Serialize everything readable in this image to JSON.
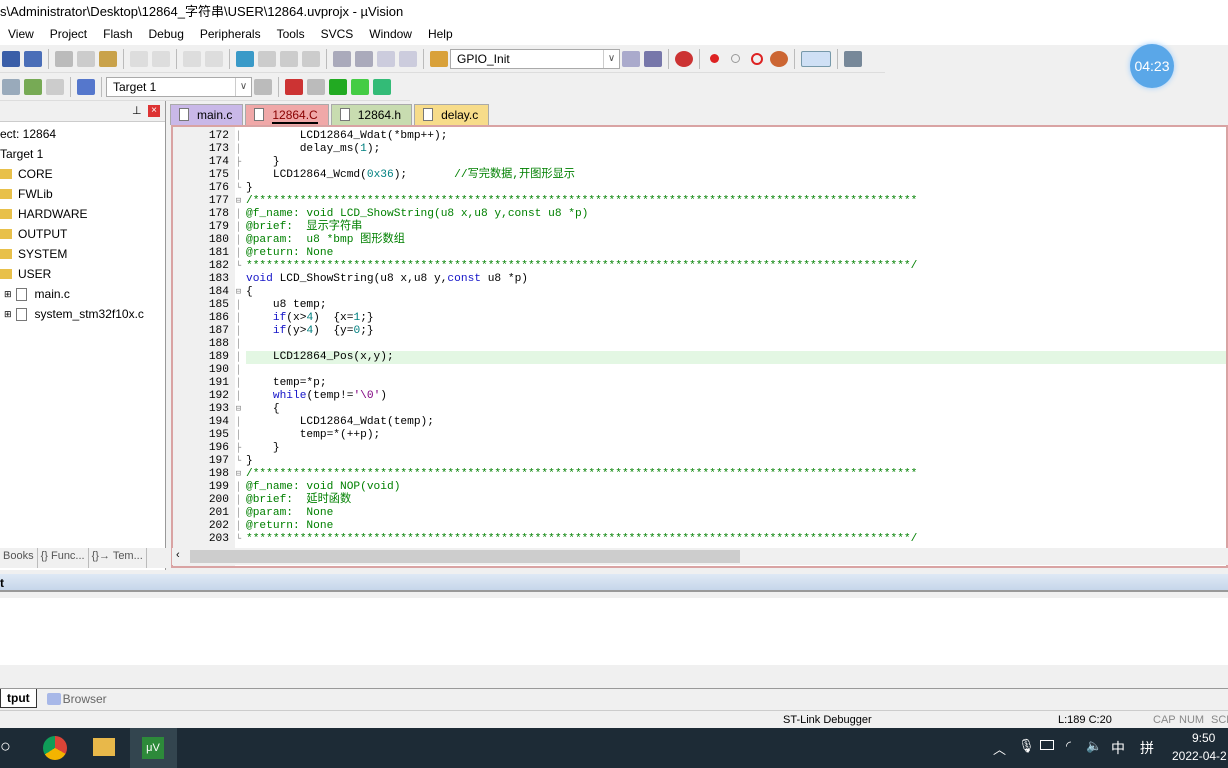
{
  "title": "s\\Administrator\\Desktop\\12864_字符串\\USER\\12864.uvprojx - µVision",
  "menu": [
    "View",
    "Project",
    "Flash",
    "Debug",
    "Peripherals",
    "Tools",
    "SVCS",
    "Window",
    "Help"
  ],
  "toolbar": {
    "function_combo": "GPIO_Init",
    "target_combo": "Target 1"
  },
  "timer": "04:23",
  "project": {
    "header_label": "ect: 12864",
    "target": "Target 1",
    "groups": [
      "CORE",
      "FWLib",
      "HARDWARE",
      "OUTPUT",
      "SYSTEM",
      "USER"
    ],
    "files": [
      "main.c",
      "system_stm32f10x.c"
    ]
  },
  "tabs": [
    {
      "label": "main.c",
      "color": "#c9b8e8"
    },
    {
      "label": "12864.C",
      "color": "#f0a8a8",
      "active": true
    },
    {
      "label": "12864.h",
      "color": "#c8dcb0"
    },
    {
      "label": "delay.c",
      "color": "#f7dc8a"
    }
  ],
  "code": [
    {
      "n": "172",
      "f": "│",
      "s": [
        [
          "        LCD12864_Wdat(*bmp++);",
          ""
        ]
      ]
    },
    {
      "n": "173",
      "f": "│",
      "s": [
        [
          "        delay_ms(",
          ""
        ],
        [
          "1",
          "n"
        ],
        [
          ");",
          ""
        ]
      ]
    },
    {
      "n": "174",
      "f": "├",
      "s": [
        [
          "    }",
          ""
        ]
      ]
    },
    {
      "n": "175",
      "f": "│",
      "s": [
        [
          "    LCD12864_Wcmd(",
          ""
        ],
        [
          "0x36",
          "n"
        ],
        [
          ");       ",
          ""
        ],
        [
          "//写完数据,开图形显示",
          "c"
        ]
      ]
    },
    {
      "n": "176",
      "f": "└",
      "s": [
        [
          "}",
          ""
        ]
      ]
    },
    {
      "n": "177",
      "f": "⊟",
      "s": [
        [
          "/***************************************************************************************************",
          "c"
        ]
      ]
    },
    {
      "n": "178",
      "f": "│",
      "s": [
        [
          "@f_name: void LCD_ShowString(u8 x,u8 y,const u8 *p)",
          "c"
        ]
      ]
    },
    {
      "n": "179",
      "f": "│",
      "s": [
        [
          "@brief:  显示字符串",
          "c"
        ]
      ]
    },
    {
      "n": "180",
      "f": "│",
      "s": [
        [
          "@param:  u8 *bmp 图形数组",
          "c"
        ]
      ]
    },
    {
      "n": "181",
      "f": "│",
      "s": [
        [
          "@return: None",
          "c"
        ]
      ]
    },
    {
      "n": "182",
      "f": "└",
      "s": [
        [
          "***************************************************************************************************/",
          "c"
        ]
      ]
    },
    {
      "n": "183",
      "f": "",
      "s": [
        [
          "void",
          "k"
        ],
        [
          " LCD_ShowString(u8 x,u8 y,",
          ""
        ],
        [
          "const",
          "k"
        ],
        [
          " u8 *p)",
          ""
        ]
      ]
    },
    {
      "n": "184",
      "f": "⊟",
      "s": [
        [
          "{",
          ""
        ]
      ]
    },
    {
      "n": "185",
      "f": "│",
      "s": [
        [
          "    u8 temp;",
          ""
        ]
      ]
    },
    {
      "n": "186",
      "f": "│",
      "s": [
        [
          "    ",
          ""
        ],
        [
          "if",
          "k"
        ],
        [
          "(x>",
          ""
        ],
        [
          "4",
          "n"
        ],
        [
          ")  {x=",
          ""
        ],
        [
          "1",
          "n"
        ],
        [
          ";}",
          ""
        ]
      ]
    },
    {
      "n": "187",
      "f": "│",
      "s": [
        [
          "    ",
          ""
        ],
        [
          "if",
          "k"
        ],
        [
          "(y>",
          ""
        ],
        [
          "4",
          "n"
        ],
        [
          ")  {y=",
          ""
        ],
        [
          "0",
          "n"
        ],
        [
          ";}",
          ""
        ]
      ]
    },
    {
      "n": "188",
      "f": "│",
      "s": [
        [
          "",
          ""
        ]
      ]
    },
    {
      "n": "189",
      "f": "│",
      "hl": true,
      "s": [
        [
          "    LCD12864_Pos(x,y);",
          ""
        ]
      ]
    },
    {
      "n": "190",
      "f": "│",
      "s": [
        [
          "",
          ""
        ]
      ]
    },
    {
      "n": "191",
      "f": "│",
      "s": [
        [
          "    temp=*p;",
          ""
        ]
      ]
    },
    {
      "n": "192",
      "f": "│",
      "s": [
        [
          "    ",
          ""
        ],
        [
          "while",
          "k"
        ],
        [
          "(temp!=",
          ""
        ],
        [
          "'\\0'",
          "s"
        ],
        [
          ")",
          ""
        ]
      ]
    },
    {
      "n": "193",
      "f": "⊟",
      "s": [
        [
          "    {",
          ""
        ]
      ]
    },
    {
      "n": "194",
      "f": "│",
      "s": [
        [
          "        LCD12864_Wdat(temp);",
          ""
        ]
      ]
    },
    {
      "n": "195",
      "f": "│",
      "s": [
        [
          "        temp=*(++p);",
          ""
        ]
      ]
    },
    {
      "n": "196",
      "f": "├",
      "s": [
        [
          "    }",
          ""
        ]
      ]
    },
    {
      "n": "197",
      "f": "└",
      "s": [
        [
          "}",
          ""
        ]
      ]
    },
    {
      "n": "198",
      "f": "⊟",
      "s": [
        [
          "/***************************************************************************************************",
          "c"
        ]
      ]
    },
    {
      "n": "199",
      "f": "│",
      "s": [
        [
          "@f_name: void NOP(void)",
          "c"
        ]
      ]
    },
    {
      "n": "200",
      "f": "│",
      "s": [
        [
          "@brief:  延时函数",
          "c"
        ]
      ]
    },
    {
      "n": "201",
      "f": "│",
      "s": [
        [
          "@param:  None",
          "c"
        ]
      ]
    },
    {
      "n": "202",
      "f": "│",
      "s": [
        [
          "@return: None",
          "c"
        ]
      ]
    },
    {
      "n": "203",
      "f": "└",
      "s": [
        [
          "***************************************************************************************************/",
          "c"
        ]
      ]
    }
  ],
  "left_tabs": [
    "Books",
    "{} Func...",
    "{}→ Tem..."
  ],
  "output_header": "t",
  "output_tabs": [
    "tput",
    "Browser"
  ],
  "status": {
    "debugger": "ST-Link Debugger",
    "position": "L:189 C:20",
    "cap": "CAP",
    "num": "NUM",
    "scrl": "SCR"
  },
  "taskbar": {
    "time": "9:50",
    "date": "2022-04-2",
    "ime": "中",
    "ime2": "拼"
  }
}
